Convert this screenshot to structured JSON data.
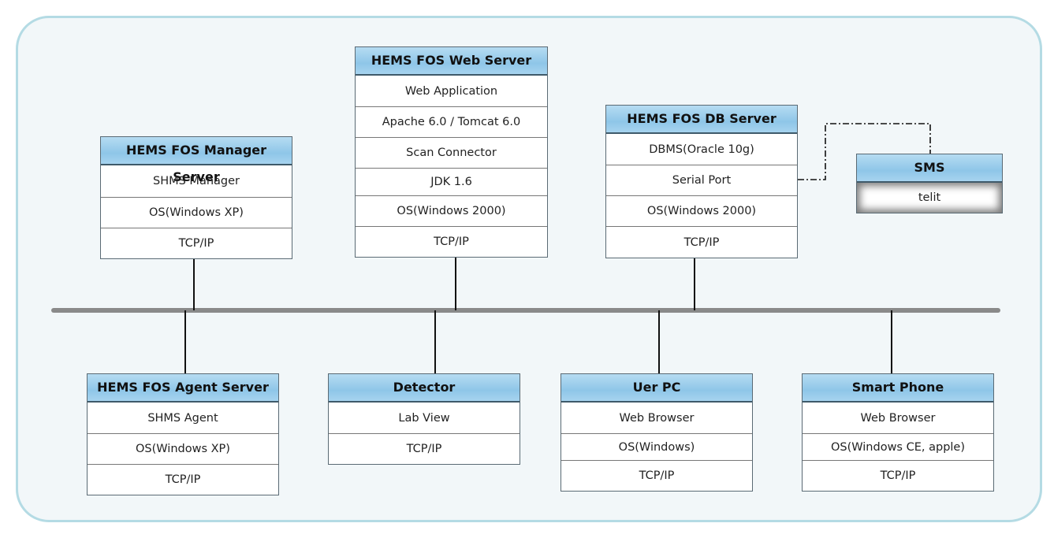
{
  "nodes": [
    {
      "id": "manager",
      "title": "HEMS FOS Manager Server",
      "rows": [
        "SHMS Manager",
        "OS(Windows XP)",
        "TCP/IP"
      ]
    },
    {
      "id": "web",
      "title": "HEMS FOS Web Server",
      "rows": [
        "Web Application",
        "Apache 6.0 / Tomcat 6.0",
        "Scan Connector",
        "JDK 1.6",
        "OS(Windows 2000)",
        "TCP/IP"
      ]
    },
    {
      "id": "db",
      "title": "HEMS FOS DB Server",
      "rows": [
        "DBMS(Oracle 10g)",
        "Serial Port",
        "OS(Windows 2000)",
        "TCP/IP"
      ]
    },
    {
      "id": "sms",
      "title": "SMS",
      "rows": [
        "telit"
      ]
    },
    {
      "id": "agent",
      "title": "HEMS FOS Agent Server",
      "rows": [
        "SHMS Agent",
        "OS(Windows XP)",
        "TCP/IP"
      ]
    },
    {
      "id": "detector",
      "title": "Detector",
      "rows": [
        "Lab View",
        "TCP/IP"
      ]
    },
    {
      "id": "userpc",
      "title": "Uer PC",
      "rows": [
        "Web Browser",
        "OS(Windows)",
        "TCP/IP"
      ]
    },
    {
      "id": "phone",
      "title": "Smart Phone",
      "rows": [
        "Web Browser",
        "OS(Windows CE, apple)",
        "TCP/IP"
      ]
    }
  ],
  "colors": {
    "header": "#8ec6e8",
    "frame_border": "#b4dbe4",
    "frame_fill": "#f2f7f9",
    "bus": "#8a8a8a"
  }
}
